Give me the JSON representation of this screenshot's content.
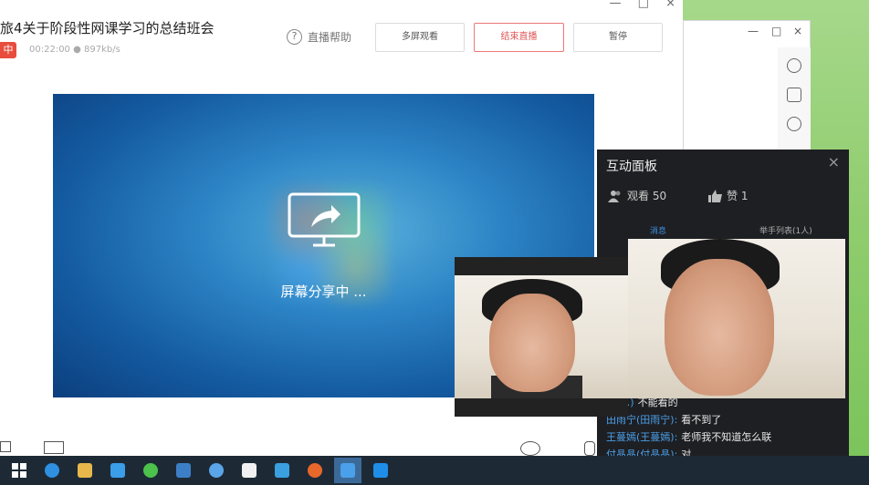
{
  "window": {
    "title": "旅4关于阶段性网课学习的总结班会",
    "live_badge": "中",
    "live_meta": "00:22:00 ● 897kb/s",
    "help_label": "直播帮助",
    "buttons": {
      "multi_scene": "多屏观看",
      "end_live": "结束直播",
      "pause": "暂停"
    }
  },
  "share": {
    "status": "屏幕分享中 ..."
  },
  "panel": {
    "title": "互动面板",
    "viewers_label": "观看 50",
    "likes_label": "赞 1",
    "tabs": [
      "消息",
      "举手列表(1人)"
    ],
    "chat": [
      {
        "user": "…(…)",
        "msg": "不能看的"
      },
      {
        "user": "田雨宁(田雨宁):",
        "msg": "看不到了"
      },
      {
        "user": "王蔓嫣(王蔓嫣):",
        "msg": "老师我不知道怎么联"
      },
      {
        "user": "付晶晶(付晶晶):",
        "msg": "对"
      }
    ]
  },
  "side_window": {
    "controls": [
      "—",
      "□",
      "×"
    ]
  },
  "taskbar": {
    "items": [
      "start",
      "ie",
      "folder",
      "media",
      "wechat",
      "mail",
      "browser-s",
      "store",
      "shield",
      "firefox",
      "app-live",
      "app-blue"
    ]
  },
  "colors": {
    "accent": "#3c8dde",
    "danger": "#e05555",
    "live_badge": "#e84c3d"
  }
}
